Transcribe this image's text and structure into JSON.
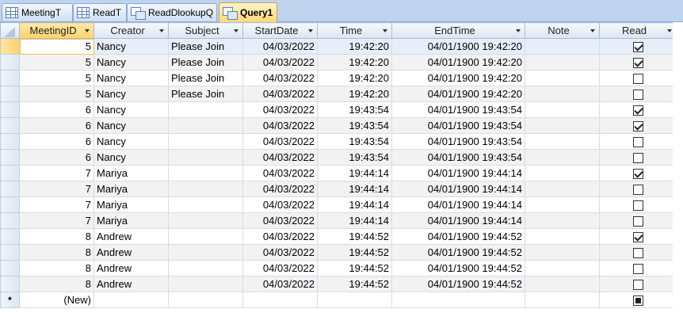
{
  "tabs": [
    {
      "label": "MeetingT",
      "icon": "table-icon",
      "active": false
    },
    {
      "label": "ReadT",
      "icon": "table-icon",
      "active": false
    },
    {
      "label": "ReadDlookupQ",
      "icon": "query-icon",
      "active": false
    },
    {
      "label": "Query1",
      "icon": "query-icon",
      "active": true
    }
  ],
  "columns": [
    {
      "key": "MeetingID",
      "label": "MeetingID"
    },
    {
      "key": "Creator",
      "label": "Creator"
    },
    {
      "key": "Subject",
      "label": "Subject"
    },
    {
      "key": "StartDate",
      "label": "StartDate"
    },
    {
      "key": "Time",
      "label": "Time"
    },
    {
      "key": "EndTime",
      "label": "EndTime"
    },
    {
      "key": "Note",
      "label": "Note"
    },
    {
      "key": "Read",
      "label": "Read"
    }
  ],
  "rows": [
    {
      "MeetingID": "5",
      "Creator": "Nancy",
      "Subject": "Please Join",
      "StartDate": "04/03/2022",
      "Time": "19:42:20",
      "EndTime": "04/01/1900 19:42:20",
      "Note": "",
      "Read": true
    },
    {
      "MeetingID": "5",
      "Creator": "Nancy",
      "Subject": "Please Join",
      "StartDate": "04/03/2022",
      "Time": "19:42:20",
      "EndTime": "04/01/1900 19:42:20",
      "Note": "",
      "Read": true
    },
    {
      "MeetingID": "5",
      "Creator": "Nancy",
      "Subject": "Please Join",
      "StartDate": "04/03/2022",
      "Time": "19:42:20",
      "EndTime": "04/01/1900 19:42:20",
      "Note": "",
      "Read": false
    },
    {
      "MeetingID": "5",
      "Creator": "Nancy",
      "Subject": "Please Join",
      "StartDate": "04/03/2022",
      "Time": "19:42:20",
      "EndTime": "04/01/1900 19:42:20",
      "Note": "",
      "Read": false
    },
    {
      "MeetingID": "6",
      "Creator": "Nancy",
      "Subject": "",
      "StartDate": "04/03/2022",
      "Time": "19:43:54",
      "EndTime": "04/01/1900 19:43:54",
      "Note": "",
      "Read": true
    },
    {
      "MeetingID": "6",
      "Creator": "Nancy",
      "Subject": "",
      "StartDate": "04/03/2022",
      "Time": "19:43:54",
      "EndTime": "04/01/1900 19:43:54",
      "Note": "",
      "Read": true
    },
    {
      "MeetingID": "6",
      "Creator": "Nancy",
      "Subject": "",
      "StartDate": "04/03/2022",
      "Time": "19:43:54",
      "EndTime": "04/01/1900 19:43:54",
      "Note": "",
      "Read": false
    },
    {
      "MeetingID": "6",
      "Creator": "Nancy",
      "Subject": "",
      "StartDate": "04/03/2022",
      "Time": "19:43:54",
      "EndTime": "04/01/1900 19:43:54",
      "Note": "",
      "Read": false
    },
    {
      "MeetingID": "7",
      "Creator": "Mariya",
      "Subject": "",
      "StartDate": "04/03/2022",
      "Time": "19:44:14",
      "EndTime": "04/01/1900 19:44:14",
      "Note": "",
      "Read": true
    },
    {
      "MeetingID": "7",
      "Creator": "Mariya",
      "Subject": "",
      "StartDate": "04/03/2022",
      "Time": "19:44:14",
      "EndTime": "04/01/1900 19:44:14",
      "Note": "",
      "Read": false
    },
    {
      "MeetingID": "7",
      "Creator": "Mariya",
      "Subject": "",
      "StartDate": "04/03/2022",
      "Time": "19:44:14",
      "EndTime": "04/01/1900 19:44:14",
      "Note": "",
      "Read": false
    },
    {
      "MeetingID": "7",
      "Creator": "Mariya",
      "Subject": "",
      "StartDate": "04/03/2022",
      "Time": "19:44:14",
      "EndTime": "04/01/1900 19:44:14",
      "Note": "",
      "Read": false
    },
    {
      "MeetingID": "8",
      "Creator": "Andrew",
      "Subject": "",
      "StartDate": "04/03/2022",
      "Time": "19:44:52",
      "EndTime": "04/01/1900 19:44:52",
      "Note": "",
      "Read": true
    },
    {
      "MeetingID": "8",
      "Creator": "Andrew",
      "Subject": "",
      "StartDate": "04/03/2022",
      "Time": "19:44:52",
      "EndTime": "04/01/1900 19:44:52",
      "Note": "",
      "Read": false
    },
    {
      "MeetingID": "8",
      "Creator": "Andrew",
      "Subject": "",
      "StartDate": "04/03/2022",
      "Time": "19:44:52",
      "EndTime": "04/01/1900 19:44:52",
      "Note": "",
      "Read": false
    },
    {
      "MeetingID": "8",
      "Creator": "Andrew",
      "Subject": "",
      "StartDate": "04/03/2022",
      "Time": "19:44:52",
      "EndTime": "04/01/1900 19:44:52",
      "Note": "",
      "Read": false
    }
  ],
  "new_row": {
    "marker": "*",
    "label": "(New)"
  },
  "current_row_index": 0
}
